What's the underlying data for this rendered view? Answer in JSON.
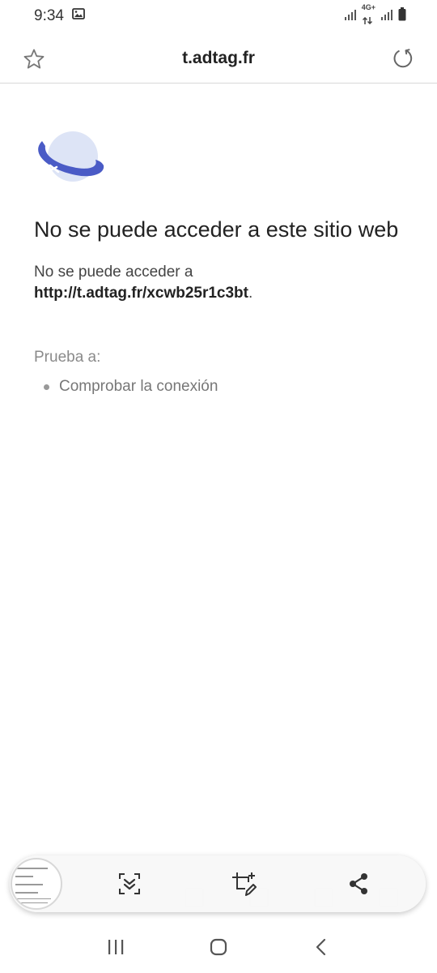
{
  "status_bar": {
    "time": "9:34",
    "network_label": "4G+",
    "icons": [
      "image-icon",
      "signal-icon",
      "data-arrows-icon",
      "signal-icon",
      "battery-icon"
    ]
  },
  "browser": {
    "url": "t.adtag.fr",
    "icons": [
      "star-icon",
      "reload-icon"
    ]
  },
  "error_page": {
    "icon": "planet-icon",
    "title": "No se puede acceder a este sitio web",
    "desc_prefix": "No se puede acceder a",
    "desc_url": "http://t.adtag.fr/xcwb25r1c3bt",
    "desc_suffix": ".",
    "try_label": "Prueba a:",
    "suggestions": [
      "Comprobar la conexión"
    ]
  },
  "capture_toolbar": {
    "icons": [
      "scroll-capture-icon",
      "crop-edit-icon",
      "share-icon"
    ]
  },
  "nav_bar": {
    "icons": [
      "recents-icon",
      "home-icon",
      "back-icon"
    ]
  },
  "colors": {
    "accent_blue": "#4a5bc6",
    "planet_fill": "#dde4f6"
  }
}
